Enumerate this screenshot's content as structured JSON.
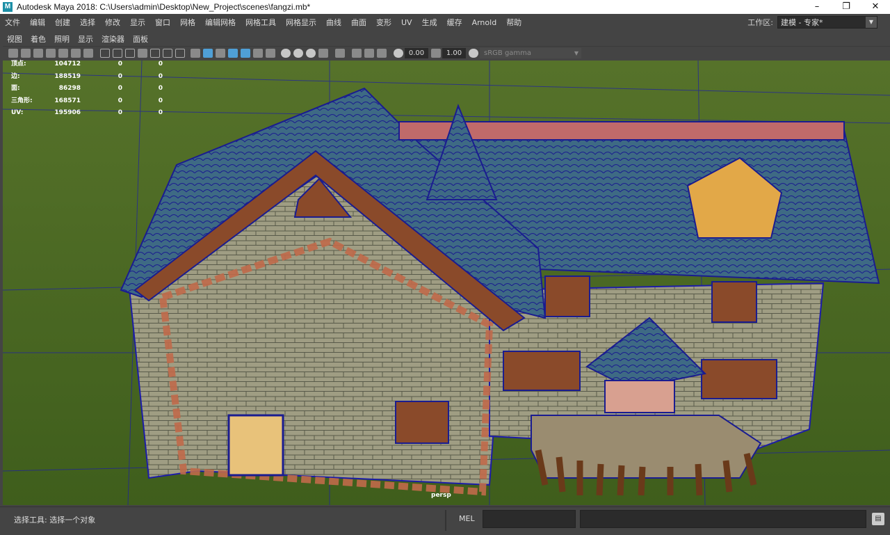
{
  "window": {
    "title": "Autodesk Maya 2018: C:\\Users\\admin\\Desktop\\New_Project\\scenes\\fangzi.mb*",
    "logo": "M"
  },
  "menubar": [
    "文件",
    "编辑",
    "创建",
    "选择",
    "修改",
    "显示",
    "窗口",
    "网格",
    "编辑网格",
    "网格工具",
    "网格显示",
    "曲线",
    "曲面",
    "变形",
    "UV",
    "生成",
    "缓存",
    "Arnold",
    "帮助"
  ],
  "workspace": {
    "label": "工作区:",
    "value": "建模 - 专家*"
  },
  "panel_menu": [
    "视图",
    "着色",
    "照明",
    "显示",
    "渲染器",
    "面板"
  ],
  "panel_toolbar": {
    "near_clip": "0.00",
    "gamma_exposure": "1.00",
    "color_space": "sRGB gamma"
  },
  "hud": [
    {
      "label": "顶点:",
      "v1": "104712",
      "v2": "0",
      "v3": "0"
    },
    {
      "label": "边:",
      "v1": "188519",
      "v2": "0",
      "v3": "0"
    },
    {
      "label": "面:",
      "v1": "86298",
      "v2": "0",
      "v3": "0"
    },
    {
      "label": "三角形:",
      "v1": "168571",
      "v2": "0",
      "v3": "0"
    },
    {
      "label": "UV:",
      "v1": "195906",
      "v2": "0",
      "v3": "0"
    }
  ],
  "camera_label": "persp",
  "status": {
    "help_line": "选择工具: 选择一个对象",
    "mel_label": "MEL"
  },
  "colors": {
    "menu_bg": "#444444",
    "grass": "#4a6a1f",
    "wireframe": "#1c1ca8",
    "roof": "#3e6e88",
    "wall": "#9c9a80",
    "brick": "#c06a4a"
  }
}
